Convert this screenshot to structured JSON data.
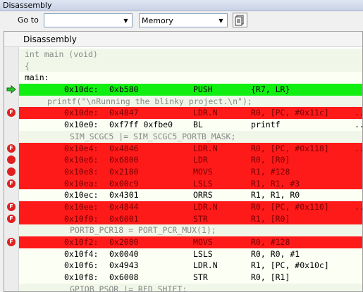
{
  "window": {
    "title": "Disassembly"
  },
  "toolbar": {
    "goto_label": "Go to",
    "goto_value": "",
    "memory_value": "Memory"
  },
  "panel": {
    "title": "Disassembly"
  },
  "lines": [
    {
      "kind": "src",
      "text": "int main (void)"
    },
    {
      "kind": "src",
      "text": "{"
    },
    {
      "kind": "label",
      "text": "main:"
    },
    {
      "kind": "asm",
      "state": "current",
      "marker": "arrow-icon",
      "addr": "0x10dc:",
      "code": "0xb580",
      "mnemonic": "PUSH",
      "operands": "{R7, LR}"
    },
    {
      "kind": "src",
      "text": "printf(\"\\nRunning the blinky project.\\n\");"
    },
    {
      "kind": "asm",
      "state": "breakpoint",
      "marker": "flash-breakpoint-icon",
      "addr": "0x10de:",
      "code": "0x4847",
      "mnemonic": "LDR.N",
      "operands": "R0, [PC, #0x11c]",
      "trail": ".."
    },
    {
      "kind": "asm",
      "state": "normal",
      "marker": "",
      "addr": "0x10e0:",
      "code": "0xf7ff 0xfbe0",
      "mnemonic": "BL",
      "operands": "printf",
      "trail": "..."
    },
    {
      "kind": "src",
      "text": "SIM_SCGC5 |= SIM_SCGC5_PORTB_MASK;"
    },
    {
      "kind": "asm",
      "state": "breakpoint",
      "marker": "flash-breakpoint-icon",
      "addr": "0x10e4:",
      "code": "0x4846",
      "mnemonic": "LDR.N",
      "operands": "R0, [PC, #0x118]",
      "trail": ".."
    },
    {
      "kind": "asm",
      "state": "breakpoint",
      "marker": "breakpoint-dot-icon",
      "addr": "0x10e6:",
      "code": "0x6800",
      "mnemonic": "LDR",
      "operands": "R0, [R0]"
    },
    {
      "kind": "asm",
      "state": "breakpoint",
      "marker": "breakpoint-dot-icon",
      "addr": "0x10e8:",
      "code": "0x2180",
      "mnemonic": "MOVS",
      "operands": "R1, #128"
    },
    {
      "kind": "asm",
      "state": "breakpoint",
      "marker": "flash-breakpoint-icon",
      "addr": "0x10ea:",
      "code": "0x00c9",
      "mnemonic": "LSLS",
      "operands": "R1, R1, #3"
    },
    {
      "kind": "asm",
      "state": "normal",
      "marker": "",
      "addr": "0x10ec:",
      "code": "0x4301",
      "mnemonic": "ORRS",
      "operands": "R1, R1, R0"
    },
    {
      "kind": "asm",
      "state": "breakpoint",
      "marker": "flash-breakpoint-icon",
      "addr": "0x10ee:",
      "code": "0x4844",
      "mnemonic": "LDR.N",
      "operands": "R0, [PC, #0x110]",
      "trail": ".."
    },
    {
      "kind": "asm",
      "state": "breakpoint",
      "marker": "flash-breakpoint-icon",
      "addr": "0x10f0:",
      "code": "0x6001",
      "mnemonic": "STR",
      "operands": "R1, [R0]"
    },
    {
      "kind": "src",
      "text": "PORTB_PCR18 = PORT_PCR_MUX(1);"
    },
    {
      "kind": "asm",
      "state": "breakpoint",
      "marker": "flash-breakpoint-icon",
      "addr": "0x10f2:",
      "code": "0x2080",
      "mnemonic": "MOVS",
      "operands": "R0, #128"
    },
    {
      "kind": "asm",
      "state": "normal",
      "marker": "",
      "addr": "0x10f4:",
      "code": "0x0040",
      "mnemonic": "LSLS",
      "operands": "R0, R0, #1"
    },
    {
      "kind": "asm",
      "state": "normal",
      "marker": "",
      "addr": "0x10f6:",
      "code": "0x4943",
      "mnemonic": "LDR.N",
      "operands": "R1, [PC, #0x10c]",
      "trail": ""
    },
    {
      "kind": "asm",
      "state": "normal",
      "marker": "",
      "addr": "0x10f8:",
      "code": "0x6008",
      "mnemonic": "STR",
      "operands": "R0, [R1]"
    },
    {
      "kind": "src",
      "text": "GPIOB_PSOR |= RED_SHIFT;"
    }
  ],
  "colors": {
    "current_line": "#11ee11",
    "breakpoint_line": "#ff1a1a",
    "source_text": "#8a8a8a"
  }
}
